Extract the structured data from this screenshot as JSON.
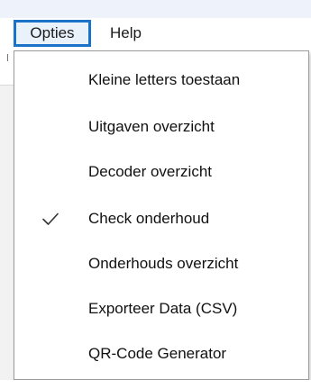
{
  "menubar": {
    "items": [
      {
        "label": "Opties",
        "active": true
      },
      {
        "label": "Help",
        "active": false
      }
    ]
  },
  "dropdown": {
    "items": [
      {
        "label": "Kleine letters toestaan",
        "checked": false
      },
      {
        "label": "Uitgaven overzicht",
        "checked": false
      },
      {
        "label": "Decoder overzicht",
        "checked": false
      },
      {
        "label": "Check onderhoud",
        "checked": true
      },
      {
        "label": "Onderhouds overzicht",
        "checked": false
      },
      {
        "label": "Exporteer Data (CSV)",
        "checked": false
      },
      {
        "label": "QR-Code Generator",
        "checked": false
      }
    ]
  },
  "colors": {
    "menubar_active_border": "#1a73c8",
    "menubar_active_fill": "#e9f1fb",
    "top_strip": "#eef2fb"
  },
  "icons": {
    "check": "check-icon"
  }
}
